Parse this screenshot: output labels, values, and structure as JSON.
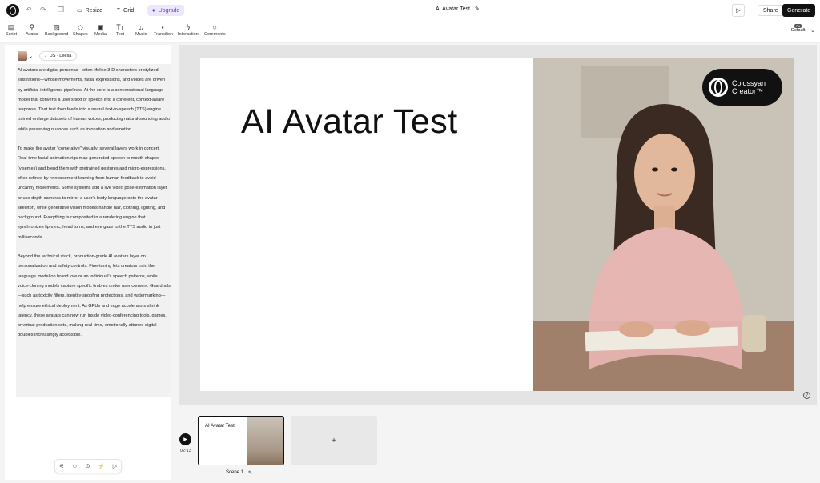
{
  "topbar": {
    "resize_label": "Resize",
    "grid_label": "Grid",
    "upgrade_label": "Upgrade",
    "project_title": "AI Avatar Test",
    "share_label": "Share",
    "generate_label": "Generate"
  },
  "toolbar": {
    "tools": [
      {
        "label": "Script",
        "icon": "script-icon"
      },
      {
        "label": "Avatar",
        "icon": "avatar-icon"
      },
      {
        "label": "Background",
        "icon": "background-icon"
      },
      {
        "label": "Shapes",
        "icon": "shapes-icon"
      },
      {
        "label": "Media",
        "icon": "media-icon"
      },
      {
        "label": "Text",
        "icon": "text-icon"
      },
      {
        "label": "Music",
        "icon": "music-icon"
      },
      {
        "label": "Transition",
        "icon": "transition-icon"
      },
      {
        "label": "Interaction",
        "icon": "interaction-icon"
      },
      {
        "label": "Comments",
        "icon": "comments-icon"
      }
    ],
    "layout_label": "Default",
    "layout_pill": "PA"
  },
  "voice": {
    "name": "US - Leesa"
  },
  "script": {
    "paragraphs": [
      "AI avatars are digital personas—often lifelike 3-D characters or stylized illustrations—whose movements, facial expressions, and voices are driven by artificial-intelligence pipelines. At the core is a conversational language model that converts a user's text or speech into a coherent, context-aware response. That text then feeds into a neural text-to-speech (TTS) engine trained on large datasets of human voices, producing natural-sounding audio while preserving nuances such as intonation and emotion.",
      "To make the avatar \"come alive\" visually, several layers work in concert. Real-time facial-animation rigs map generated speech to mouth shapes (visemes) and blend them with pretrained gestures and micro-expressions, often refined by reinforcement learning from human feedback to avoid uncanny movements. Some systems add a live video pose-estimation layer or use depth cameras to mirror a user's body language onto the avatar skeleton, while generative vision models handle hair, clothing, lighting, and background. Everything is composited in a rendering engine that synchronizes lip-sync, head turns, and eye gaze to the TTS audio in just milliseconds.",
      "Beyond the technical stack, production-grade AI avatars layer on personalization and safety controls. Fine-tuning lets creators train the language model on brand lore or an individual's speech patterns, while voice-cloning models capture specific timbres under user consent. Guardrails—such as toxicity filters, identity-spoofing protections, and watermarking—help ensure ethical deployment. As GPUs and edge accelerators shrink latency, these avatars can now run inside video-conferencing tools, games, or virtual-production sets, making real-time, emotionally attuned digital doubles increasingly accessible."
    ]
  },
  "slide": {
    "title": "AI Avatar Test",
    "badge_text_1": "Colossyan",
    "badge_text_2": "Creator™"
  },
  "timeline": {
    "time": "02:13",
    "scene_title": "AI Avatar Test",
    "scene_label": "Scene 1",
    "add_label": "+"
  }
}
